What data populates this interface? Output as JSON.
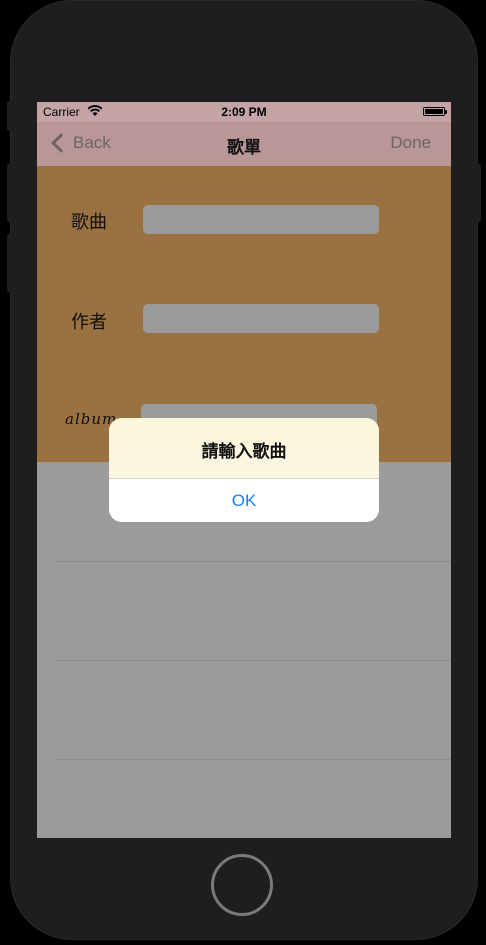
{
  "status_bar": {
    "carrier": "Carrier",
    "time": "2:09 PM",
    "icons": [
      "wifi-icon",
      "battery-icon"
    ]
  },
  "nav_bar": {
    "back_label": "Back",
    "title": "歌單",
    "done_label": "Done"
  },
  "form": {
    "song_label": "歌曲",
    "author_label": "作者",
    "album_label": "album",
    "song_value": "",
    "author_value": "",
    "album_value": ""
  },
  "alert": {
    "title": "請輸入歌曲",
    "ok_label": "OK"
  },
  "colors": {
    "form_background": "#9a7140",
    "nav_background": "#b99698",
    "alert_button_text": "#1a7ef0"
  }
}
